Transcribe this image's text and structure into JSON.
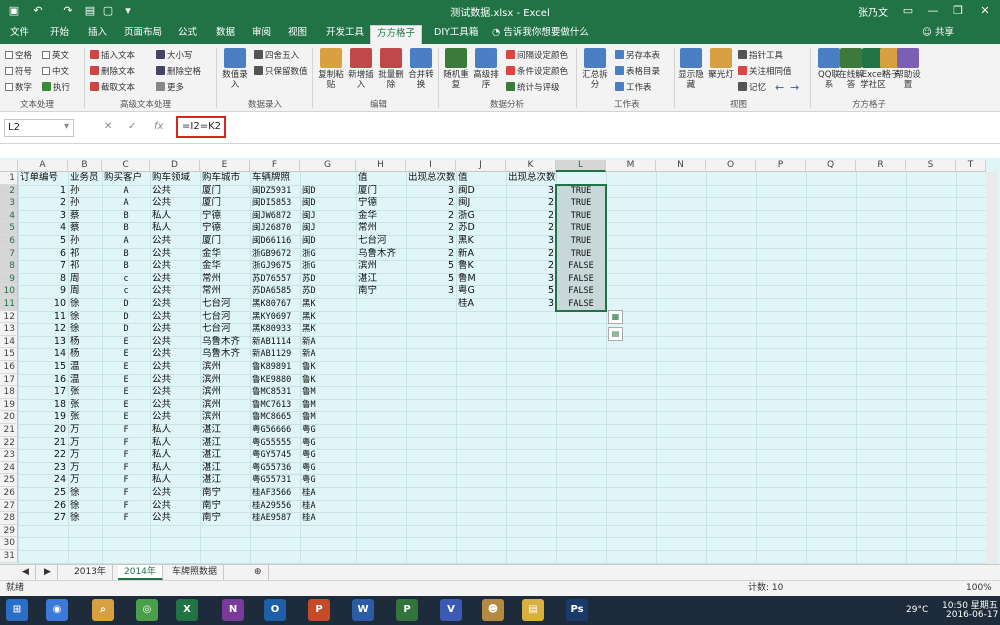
{
  "window": {
    "title": "测试数据.xlsx - Excel",
    "user": "张乃文",
    "quick_access": [
      "save-icon",
      "undo-icon",
      "redo-icon",
      "customize-icon"
    ],
    "controls": [
      "ribbon-display-icon",
      "minimize-icon",
      "maximize-icon",
      "close-icon"
    ]
  },
  "ribbon_tabs": [
    {
      "label": "文件",
      "active": false
    },
    {
      "label": "开始",
      "active": false
    },
    {
      "label": "插入",
      "active": false
    },
    {
      "label": "页面布局",
      "active": false
    },
    {
      "label": "公式",
      "active": false
    },
    {
      "label": "数据",
      "active": false
    },
    {
      "label": "审阅",
      "active": false
    },
    {
      "label": "视图",
      "active": false
    },
    {
      "label": "开发工具",
      "active": false
    },
    {
      "label": "方方格子",
      "active": true
    },
    {
      "label": "DIY工具箱",
      "active": false
    }
  ],
  "tell_me": "告诉我你想要做什么",
  "share": "共享",
  "ribbon": {
    "text_processing": {
      "label": "文本处理",
      "checks": [
        "空格",
        "英文",
        "符号",
        "中文",
        "数字",
        "执行"
      ]
    },
    "advanced_text": {
      "label": "高级文本处理",
      "items": [
        "插入文本",
        "大小写",
        "删除文本",
        "删除空格",
        "截取文本",
        "更多"
      ]
    },
    "data_entry": {
      "label": "数据录入",
      "items": [
        "数值录入",
        "四舍五入",
        "只保留数值",
        "复制粘贴"
      ]
    },
    "edit": {
      "label": "编辑",
      "items": [
        "复制粘贴",
        "新增插入",
        "批量删除",
        "合并转换"
      ]
    },
    "data_analysis": {
      "label": "数据分析",
      "items": [
        "随机重复",
        "高级排序",
        "间隔设定颜色",
        "条件设定颜色",
        "统计与评级"
      ]
    },
    "worksheet": {
      "label": "工作表",
      "items": [
        "汇总拆分",
        "另存本表",
        "表格目录",
        "工作表"
      ]
    },
    "view": {
      "label": "视图",
      "items": [
        "显示隐藏",
        "聚光灯",
        "指针工具",
        "关注相同值",
        "记忆"
      ]
    },
    "fangfang": {
      "label": "方方格子",
      "items": [
        "QQ联系",
        "在线解答",
        "Excel学社区",
        "格子",
        "帮助设置"
      ]
    }
  },
  "formula_bar": {
    "name_box": "L2",
    "formula": "=I2=K2"
  },
  "columns": [
    "A",
    "B",
    "C",
    "D",
    "E",
    "F",
    "G",
    "H",
    "I",
    "J",
    "K",
    "L",
    "M",
    "N",
    "O",
    "P",
    "Q",
    "R",
    "S",
    "T"
  ],
  "rows": [
    "1",
    "2",
    "3",
    "4",
    "5",
    "6",
    "7",
    "8",
    "9",
    "10",
    "11",
    "12",
    "13",
    "14",
    "15",
    "16",
    "17",
    "18",
    "19",
    "20",
    "21",
    "22",
    "23",
    "24",
    "25",
    "26",
    "27",
    "28",
    "29",
    "30",
    "31"
  ],
  "sheet": {
    "headers": [
      "订单编号",
      "业务员",
      "购买客户",
      "购车领域",
      "购车城市",
      "车辆牌照",
      "",
      "值",
      "出现总次数",
      "值",
      "出现总次数",
      ""
    ],
    "main_rows": [
      [
        "1",
        "孙",
        "A",
        "公共",
        "厦门",
        "闽DZ5931",
        "闽D"
      ],
      [
        "2",
        "孙",
        "A",
        "公共",
        "厦门",
        "闽DI5853",
        "闽D"
      ],
      [
        "3",
        "蔡",
        "B",
        "私人",
        "宁德",
        "闽JW6872",
        "闽J"
      ],
      [
        "4",
        "蔡",
        "B",
        "私人",
        "宁德",
        "闽J26870",
        "闽J"
      ],
      [
        "5",
        "孙",
        "A",
        "公共",
        "厦门",
        "闽D66116",
        "闽D"
      ],
      [
        "6",
        "祁",
        "B",
        "公共",
        "金华",
        "浙GB9672",
        "浙G"
      ],
      [
        "7",
        "祁",
        "B",
        "公共",
        "金华",
        "浙GJ9675",
        "浙G"
      ],
      [
        "8",
        "周",
        "c",
        "公共",
        "常州",
        "苏D76557",
        "苏D"
      ],
      [
        "9",
        "周",
        "c",
        "公共",
        "常州",
        "苏DA6585",
        "苏D"
      ],
      [
        "10",
        "徐",
        "D",
        "公共",
        "七台河",
        "黑K80767",
        "黑K"
      ],
      [
        "11",
        "徐",
        "D",
        "公共",
        "七台河",
        "黑KY0697",
        "黑K"
      ],
      [
        "12",
        "徐",
        "D",
        "公共",
        "七台河",
        "黑K80933",
        "黑K"
      ],
      [
        "13",
        "杨",
        "E",
        "公共",
        "乌鲁木齐",
        "新AB1114",
        "新A"
      ],
      [
        "14",
        "杨",
        "E",
        "公共",
        "乌鲁木齐",
        "新AB1129",
        "新A"
      ],
      [
        "15",
        "温",
        "E",
        "公共",
        "滨州",
        "鲁K89891",
        "鲁K"
      ],
      [
        "16",
        "温",
        "E",
        "公共",
        "滨州",
        "鲁KE9880",
        "鲁K"
      ],
      [
        "17",
        "张",
        "E",
        "公共",
        "滨州",
        "鲁MC8531",
        "鲁M"
      ],
      [
        "18",
        "张",
        "E",
        "公共",
        "滨州",
        "鲁MC7613",
        "鲁M"
      ],
      [
        "19",
        "张",
        "E",
        "公共",
        "滨州",
        "鲁MC8665",
        "鲁M"
      ],
      [
        "20",
        "万",
        "F",
        "私人",
        "湛江",
        "粤G56666",
        "粤G"
      ],
      [
        "21",
        "万",
        "F",
        "私人",
        "湛江",
        "粤G55555",
        "粤G"
      ],
      [
        "22",
        "万",
        "F",
        "私人",
        "湛江",
        "粤GY5745",
        "粤G"
      ],
      [
        "23",
        "万",
        "F",
        "私人",
        "湛江",
        "粤G55736",
        "粤G"
      ],
      [
        "24",
        "万",
        "F",
        "私人",
        "湛江",
        "粤G55731",
        "粤G"
      ],
      [
        "25",
        "徐",
        "F",
        "公共",
        "南宁",
        "桂AF3566",
        "桂A"
      ],
      [
        "26",
        "徐",
        "F",
        "公共",
        "南宁",
        "桂A29556",
        "桂A"
      ],
      [
        "27",
        "徐",
        "F",
        "公共",
        "南宁",
        "桂AE9587",
        "桂A"
      ]
    ],
    "side_rows": [
      [
        "厦门",
        "3",
        "闽D",
        "3",
        "TRUE"
      ],
      [
        "宁德",
        "2",
        "闽J",
        "2",
        "TRUE"
      ],
      [
        "金华",
        "2",
        "浙G",
        "2",
        "TRUE"
      ],
      [
        "常州",
        "2",
        "苏D",
        "2",
        "TRUE"
      ],
      [
        "七台河",
        "3",
        "黑K",
        "3",
        "TRUE"
      ],
      [
        "乌鲁木齐",
        "2",
        "新A",
        "2",
        "TRUE"
      ],
      [
        "滨州",
        "5",
        "鲁K",
        "2",
        "FALSE"
      ],
      [
        "湛江",
        "5",
        "鲁M",
        "3",
        "FALSE"
      ],
      [
        "南宁",
        "3",
        "粤G",
        "5",
        "FALSE"
      ],
      [
        "",
        "",
        "桂A",
        "3",
        "FALSE"
      ]
    ]
  },
  "sheet_tabs": [
    {
      "label": "2013年",
      "active": false
    },
    {
      "label": "2014年",
      "active": true
    },
    {
      "label": "车牌照数据",
      "active": false
    }
  ],
  "status": {
    "ready": "就绪",
    "count": "计数: 10",
    "zoom": "100%"
  },
  "taskbar": {
    "apps": [
      "start-icon",
      "explorer-icon",
      "search-icon",
      "360-icon",
      "excel-icon",
      "onenote-icon",
      "outlook-icon",
      "powerpoint-icon",
      "word-icon",
      "project-icon",
      "visio-icon",
      "cat-icon",
      "files-icon",
      "photoshop-icon"
    ],
    "temp": "29°C",
    "time": "10:50 星期五",
    "date": "2016-06-17"
  },
  "colors": {
    "excel_green": "#217346",
    "grid_bg": "#dff5f8",
    "highlight_red": "#dd2222"
  }
}
